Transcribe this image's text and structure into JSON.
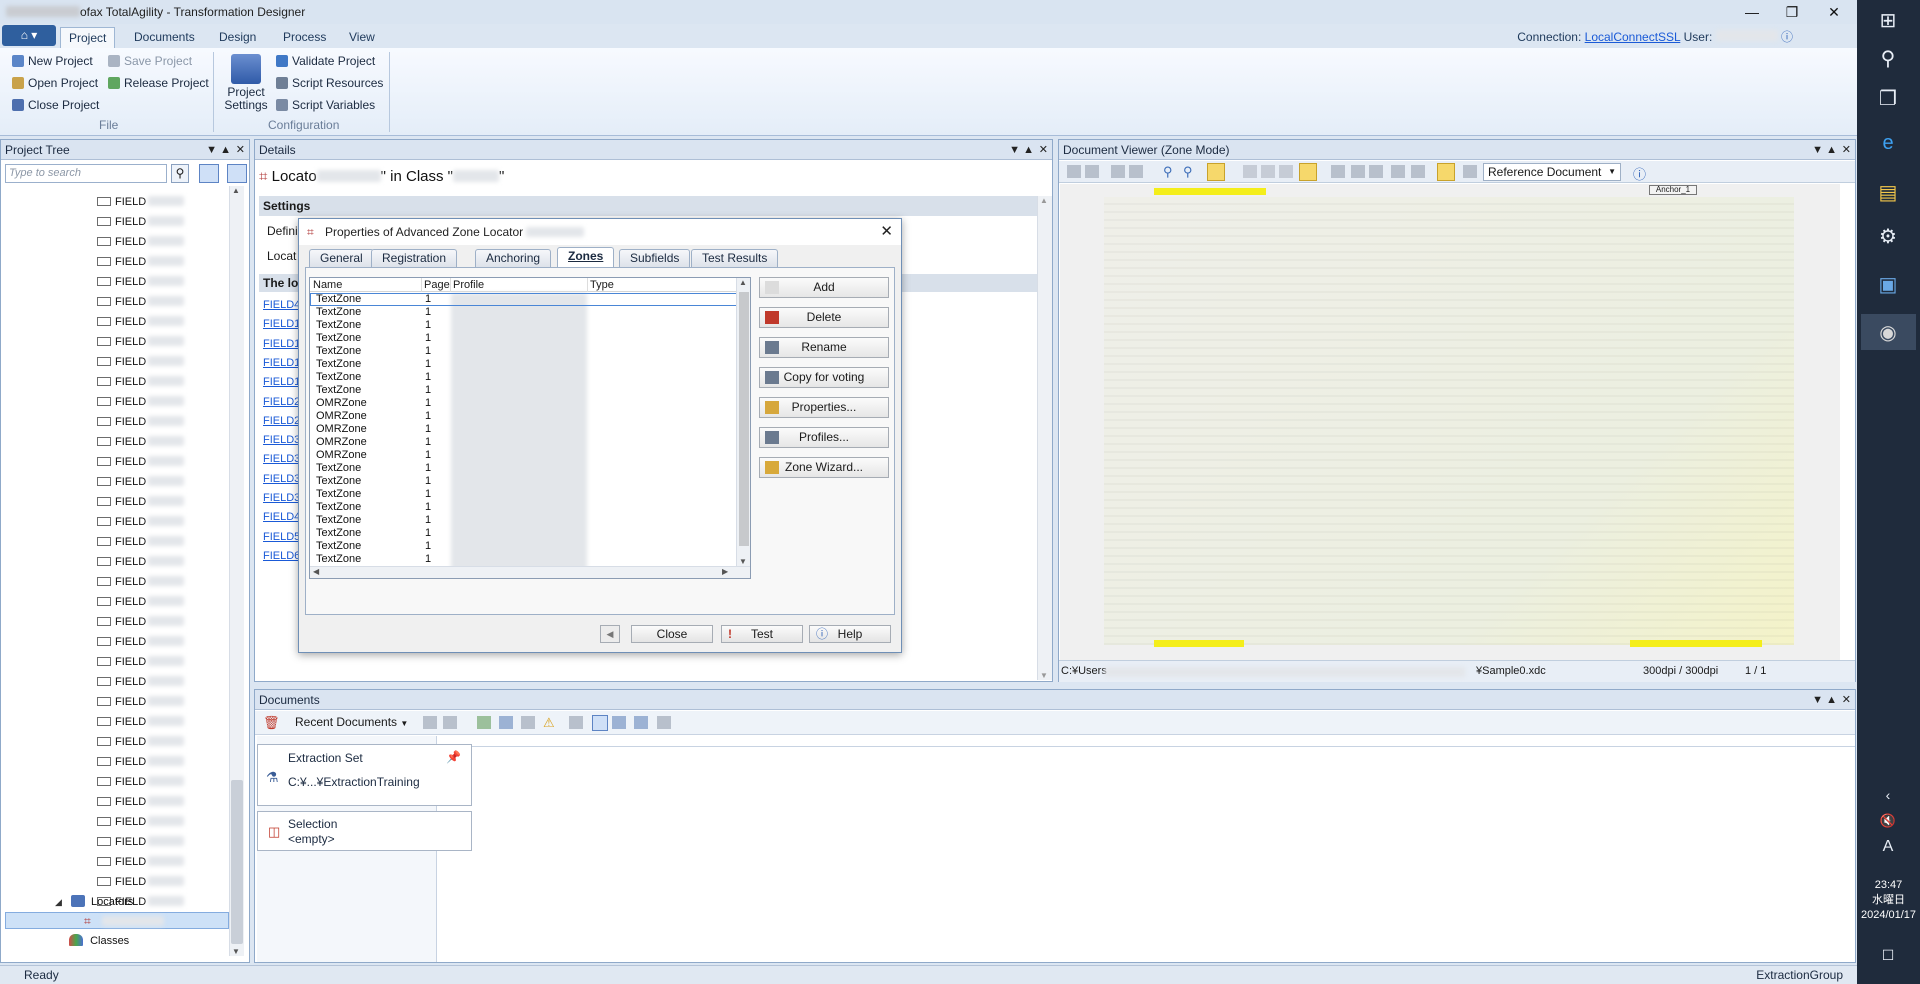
{
  "window": {
    "title": "ofax TotalAgility - Transformation Designer",
    "min": "—",
    "restore": "❐",
    "close": "✕"
  },
  "ribbon": {
    "app_menu": "⌂ ▾",
    "tabs": [
      {
        "label": "Project"
      },
      {
        "label": "Documents"
      },
      {
        "label": "Design"
      },
      {
        "label": "Process"
      },
      {
        "label": "View"
      }
    ],
    "connection_label": "Connection:",
    "connection_value": "LocalConnectSSL",
    "user_label": "User:",
    "file_group": {
      "label": "File",
      "new": "New Project",
      "open": "Open Project",
      "close": "Close Project",
      "save": "Save Project",
      "release": "Release Project"
    },
    "config_group": {
      "label": "Configuration",
      "settings_line1": "Project",
      "settings_line2": "Settings",
      "validate": "Validate Project",
      "script_resources": "Script Resources",
      "script_variables": "Script Variables"
    }
  },
  "project_tree": {
    "title": "Project Tree",
    "search_placeholder": "Type to search",
    "field_label": "FIELD",
    "field_count": 36,
    "locators_label": "Locators",
    "classes_label": "Classes"
  },
  "details": {
    "title": "Details",
    "heading_part1": "Locato",
    "heading_part2": "\" in Class \"",
    "heading_part3": "\"",
    "settings_label": "Settings",
    "definition_label": "Defini",
    "locator_label": "Locat",
    "desc_label": "The lo",
    "links": [
      "FIELD4",
      "FIELD1",
      "FIELD1",
      "FIELD1",
      "FIELD1",
      "FIELD2",
      "FIELD2",
      "FIELD3",
      "FIELD3",
      "FIELD3",
      "FIELD3",
      "FIELD4",
      "FIELD5",
      "FIELD6"
    ]
  },
  "dialog": {
    "title": "Properties of Advanced Zone Locator",
    "tabs": [
      "General",
      "Registration",
      "Anchoring",
      "Zones",
      "Subfields",
      "Test Results"
    ],
    "active_tab": "Zones",
    "columns": [
      "Name",
      "Page",
      "Profile",
      "Type"
    ],
    "rows": [
      {
        "name": "TextZone",
        "page": "1"
      },
      {
        "name": "TextZone",
        "page": "1"
      },
      {
        "name": "TextZone",
        "page": "1"
      },
      {
        "name": "TextZone",
        "page": "1"
      },
      {
        "name": "TextZone",
        "page": "1"
      },
      {
        "name": "TextZone",
        "page": "1"
      },
      {
        "name": "TextZone",
        "page": "1"
      },
      {
        "name": "TextZone",
        "page": "1"
      },
      {
        "name": "OMRZone",
        "page": "1"
      },
      {
        "name": "OMRZone",
        "page": "1"
      },
      {
        "name": "OMRZone",
        "page": "1"
      },
      {
        "name": "OMRZone",
        "page": "1"
      },
      {
        "name": "OMRZone",
        "page": "1"
      },
      {
        "name": "TextZone",
        "page": "1"
      },
      {
        "name": "TextZone",
        "page": "1"
      },
      {
        "name": "TextZone",
        "page": "1"
      },
      {
        "name": "TextZone",
        "page": "1"
      },
      {
        "name": "TextZone",
        "page": "1"
      },
      {
        "name": "TextZone",
        "page": "1"
      },
      {
        "name": "TextZone",
        "page": "1"
      },
      {
        "name": "TextZone",
        "page": "1"
      },
      {
        "name": "TextZone",
        "page": "1"
      }
    ],
    "buttons": [
      "Add",
      "Delete",
      "Rename",
      "Copy for voting",
      "Properties...",
      "Profiles...",
      "Zone Wizard..."
    ],
    "close": "Close",
    "test": "Test",
    "help": "Help"
  },
  "viewer": {
    "title": "Document Viewer (Zone Mode)",
    "reference_doc": "Reference Document",
    "anchor_label": "Anchor_1",
    "path_left": "C:¥Users",
    "path_right": "¥Sample0.xdc",
    "dpi": "300dpi / 300dpi",
    "pages": "1 / 1"
  },
  "documents": {
    "title": "Documents",
    "recent": "Recent Documents",
    "extraction_set": "Extraction Set",
    "extraction_path": "C:¥...¥ExtractionTraining",
    "selection": "Selection",
    "selection_value": "<empty>"
  },
  "status": {
    "left": "Ready",
    "right": "ExtractionGroup"
  },
  "taskbar": {
    "time": "23:47",
    "day": "水曜日",
    "date": "2024/01/17",
    "ime": "A"
  }
}
